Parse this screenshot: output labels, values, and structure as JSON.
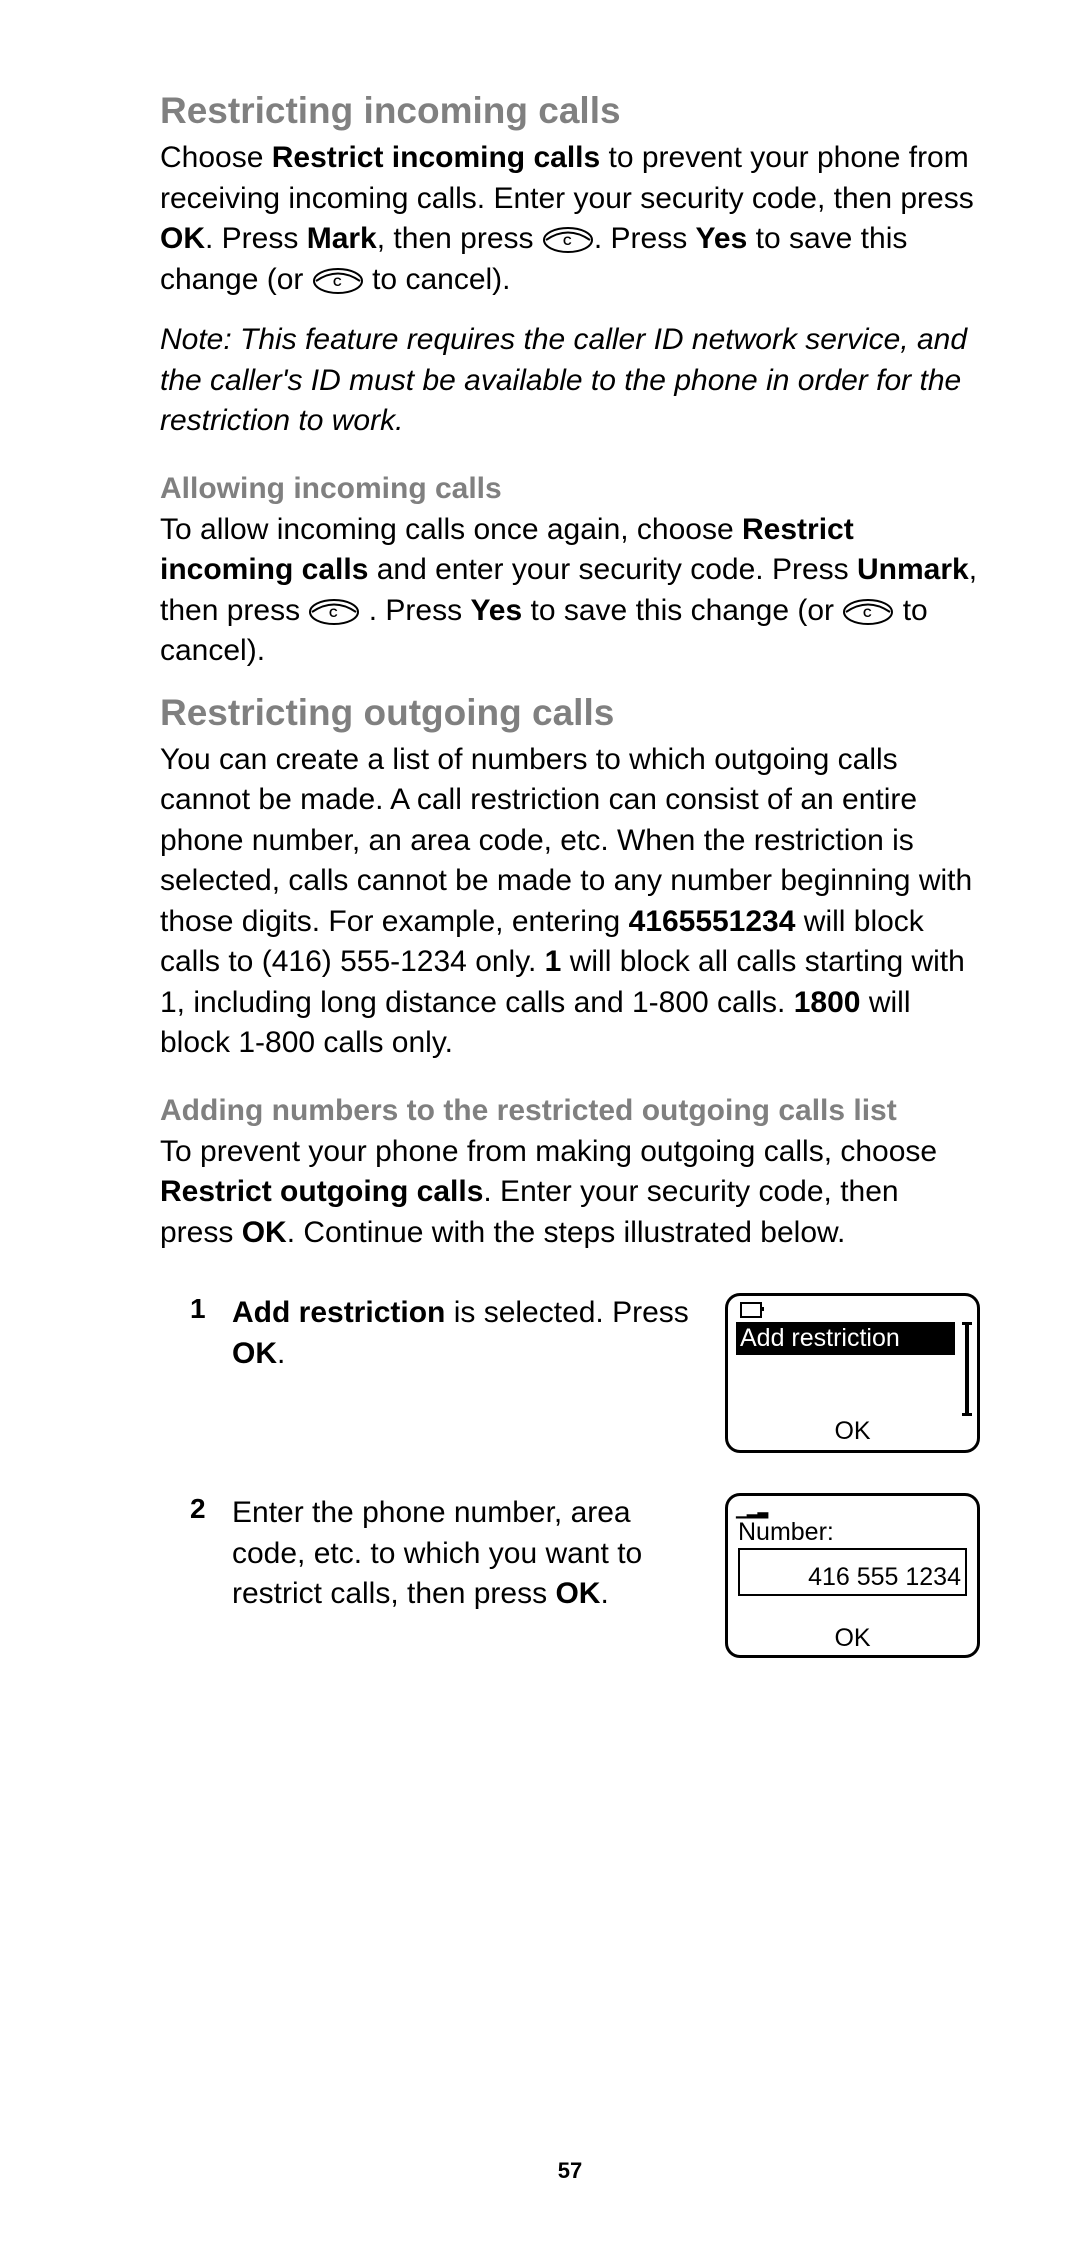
{
  "page_number": "57",
  "sections": {
    "incoming": {
      "title": "Restricting incoming calls",
      "p1_a": "Choose ",
      "p1_b": "Restrict incoming calls",
      "p1_c": " to prevent your phone from receiving incoming calls. Enter your security code, then press ",
      "p1_d": "OK",
      "p1_e": ". Press ",
      "p1_f": "Mark",
      "p1_g": ", then press ",
      "p1_h": ". Press ",
      "p1_i": "Yes",
      "p1_j": " to save this change (or ",
      "p1_k": " to cancel).",
      "note": "Note:  This feature requires the caller ID network service, and the caller's ID must be available to the phone in order for the restriction to work.",
      "sub_title": "Allowing incoming calls",
      "p2_a": "To allow incoming calls once again, choose ",
      "p2_b": "Restrict incoming calls",
      "p2_c": " and enter your security code. Press ",
      "p2_d": "Unmark",
      "p2_e": ", then press ",
      "p2_f": " . Press ",
      "p2_g": "Yes",
      "p2_h": " to save this change (or ",
      "p2_i": " to cancel)."
    },
    "outgoing": {
      "title": "Restricting outgoing calls",
      "p1_a": "You can create a list of numbers to which outgoing calls cannot be made. A call restriction can consist of an entire phone number, an area code, etc. When the restriction is selected, calls cannot be made to any number beginning with those digits. For example, entering ",
      "p1_b": "4165551234",
      "p1_c": " will block calls to (416) 555-1234 only. ",
      "p1_d": "1",
      "p1_e": " will block all calls starting with 1, including long distance calls and 1-800 calls. ",
      "p1_f": "1800",
      "p1_g": " will block 1-800 calls only.",
      "sub_title": "Adding numbers to the restricted outgoing calls list",
      "p2_a": "To prevent your phone from making outgoing calls, choose ",
      "p2_b": "Restrict outgoing calls",
      "p2_c": ". Enter your security code, then press ",
      "p2_d": "OK",
      "p2_e": ". Continue with the steps illustrated below.",
      "steps": {
        "s1": {
          "num": "1",
          "a": "Add restriction",
          "b": " is selected. Press ",
          "c": "OK",
          "d": "."
        },
        "s2": {
          "num": "2",
          "a": "Enter the phone number, area code, etc. to which you want to restrict calls, then press ",
          "b": "OK",
          "c": "."
        }
      }
    }
  },
  "figures": {
    "fig1": {
      "highlight": "Add restriction",
      "softkey": "OK"
    },
    "fig2": {
      "label": "Number:",
      "value": "416 555 1234",
      "softkey": "OK"
    }
  }
}
